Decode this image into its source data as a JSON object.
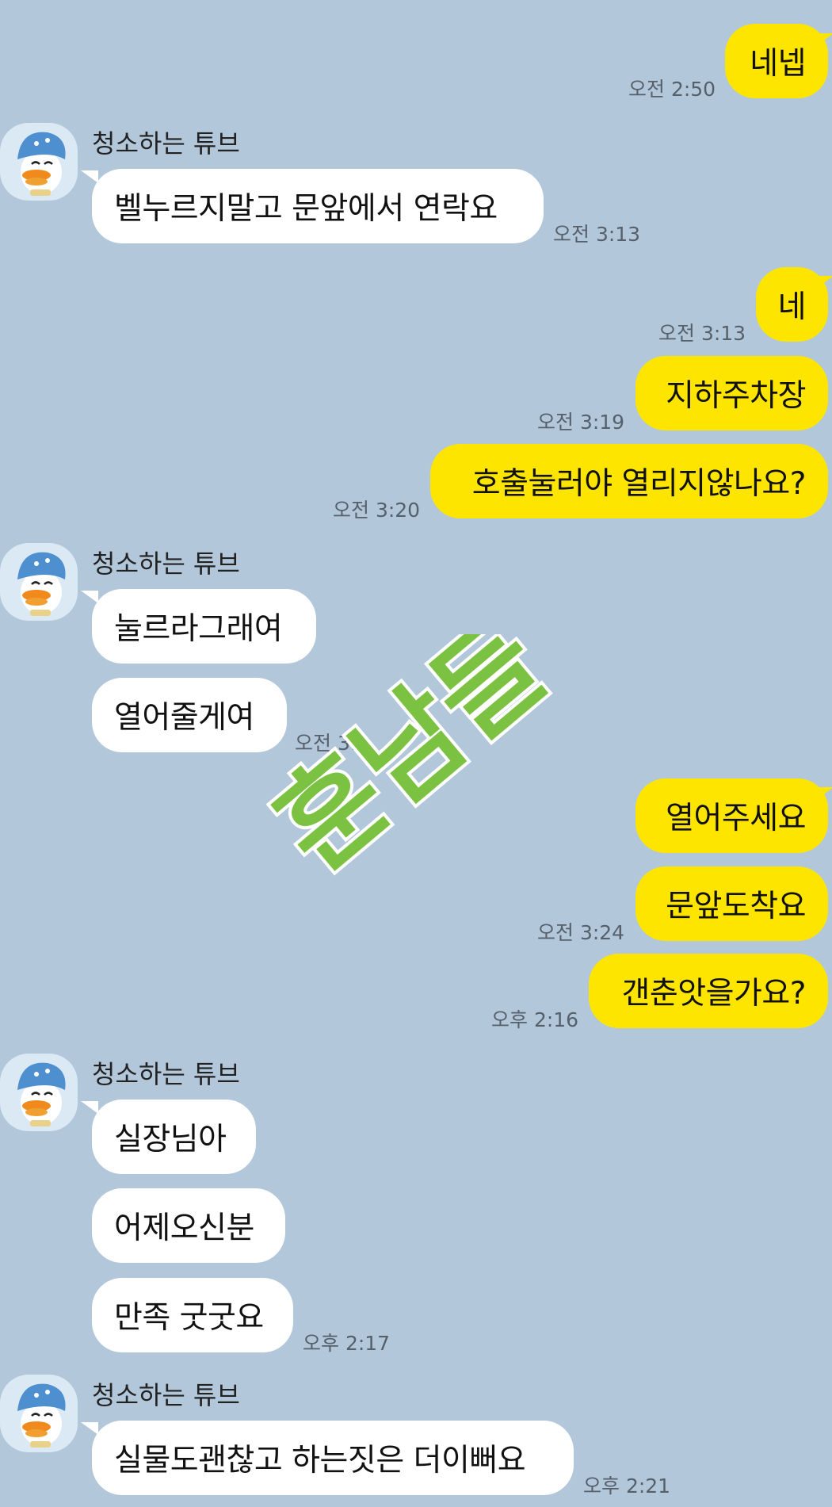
{
  "chat": {
    "sender_name": "청소하는 튜브",
    "messages": [
      {
        "text": "네넵",
        "time": "오전 2:50"
      },
      {
        "text": "벨누르지말고 문앞에서 연락요",
        "time": "오전 3:13"
      },
      {
        "text": "네",
        "time": "오전 3:13"
      },
      {
        "text": "지하주차장",
        "time": "오전 3:19"
      },
      {
        "text": "호출눌러야 열리지않나요?",
        "time": "오전 3:20"
      },
      {
        "text": "눌르라그래여"
      },
      {
        "text": "열어줄게여",
        "time": "오전 3:.."
      },
      {
        "text": "열어주세요"
      },
      {
        "text": "문앞도착요",
        "time": "오전 3:24"
      },
      {
        "text": "갠춘앗을가요?",
        "time": "오후 2:16"
      },
      {
        "text": "실장님아"
      },
      {
        "text": "어제오신분"
      },
      {
        "text": "만족 굿굿요",
        "time": "오후 2:17"
      },
      {
        "text": "실물도괜찮고 하는짓은 더이뻐요",
        "time": "오후 2:21"
      }
    ]
  },
  "watermark": {
    "text": "훈남들"
  },
  "colors": {
    "background": "#b2c7da",
    "my_bubble": "#fee500",
    "their_bubble": "#ffffff",
    "timestamp": "#56606a"
  },
  "icons": {
    "avatar": "tube-duck-avatar-icon"
  }
}
